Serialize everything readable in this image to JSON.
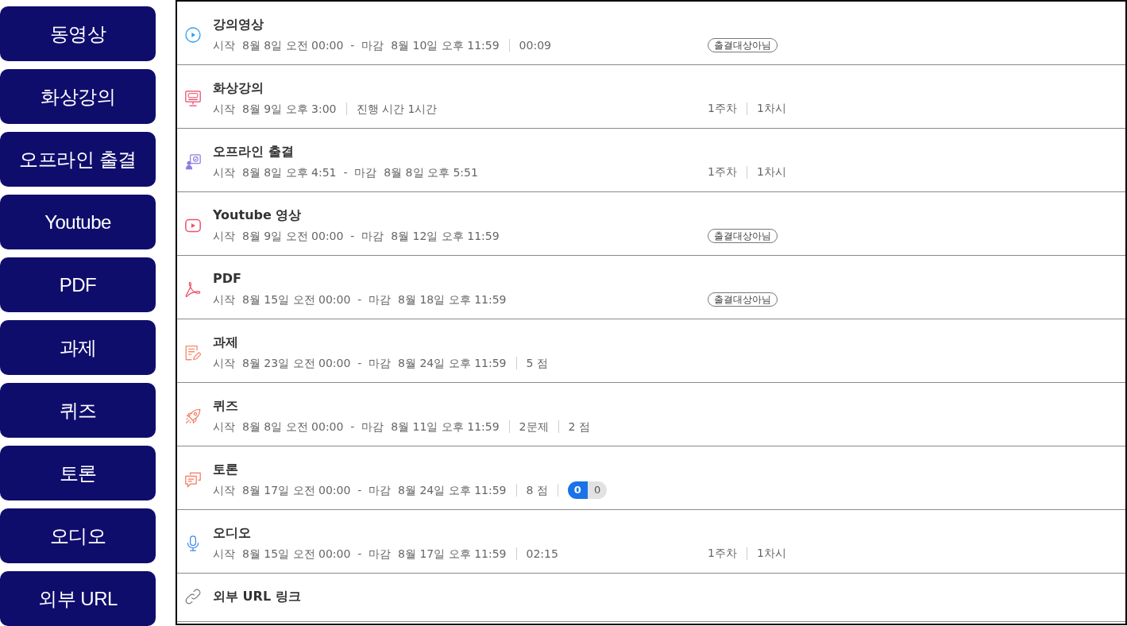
{
  "sidebar": {
    "buttons": [
      "동영상",
      "화상강의",
      "오프라인 출결",
      "Youtube",
      "PDF",
      "과제",
      "퀴즈",
      "토론",
      "오디오",
      "외부 URL"
    ]
  },
  "list": {
    "items": [
      {
        "kind": "video",
        "title": "강의영상",
        "meta": [
          "시작  8월 8일 오전 00:00  -  마감  8월 10일 오후 11:59",
          "00:09"
        ],
        "aside": {
          "kind": "tag",
          "text": "출결대상아님"
        }
      },
      {
        "kind": "live",
        "title": "화상강의",
        "meta": [
          "시작  8월 9일 오후 3:00",
          "진행 시간 1시간"
        ],
        "aside": {
          "kind": "week",
          "parts": [
            "1주차",
            "1차시"
          ]
        }
      },
      {
        "kind": "offline",
        "title": "오프라인 출결",
        "meta": [
          "시작  8월 8일 오후 4:51  -  마감  8월 8일 오후 5:51"
        ],
        "aside": {
          "kind": "week",
          "parts": [
            "1주차",
            "1차시"
          ]
        }
      },
      {
        "kind": "youtube",
        "title": "Youtube 영상",
        "meta": [
          "시작  8월 9일 오전 00:00  -  마감  8월 12일 오후 11:59"
        ],
        "aside": {
          "kind": "tag",
          "text": "출결대상아님"
        }
      },
      {
        "kind": "pdf",
        "title": "PDF",
        "meta": [
          "시작  8월 15일 오전 00:00  -  마감  8월 18일 오후 11:59"
        ],
        "aside": {
          "kind": "tag",
          "text": "출결대상아님"
        }
      },
      {
        "kind": "assignment",
        "title": "과제",
        "meta": [
          "시작  8월 23일 오전 00:00  -  마감  8월 24일 오후 11:59",
          "5 점"
        ]
      },
      {
        "kind": "quiz",
        "title": "퀴즈",
        "meta": [
          "시작  8월 8일 오전 00:00  -  마감  8월 11일 오후 11:59",
          "2문제",
          "2 점"
        ]
      },
      {
        "kind": "discussion",
        "title": "토론",
        "meta": [
          "시작  8월 17일 오전 00:00  -  마감  8월 24일 오후 11:59",
          "8 점"
        ],
        "counter": [
          "0",
          "0"
        ]
      },
      {
        "kind": "audio",
        "title": "오디오",
        "meta": [
          "시작  8월 15일 오전 00:00  -  마감  8월 17일 오후 11:59",
          "02:15"
        ],
        "aside": {
          "kind": "week",
          "parts": [
            "1주차",
            "1차시"
          ]
        }
      },
      {
        "kind": "link",
        "title": "외부 URL 링크"
      }
    ]
  }
}
